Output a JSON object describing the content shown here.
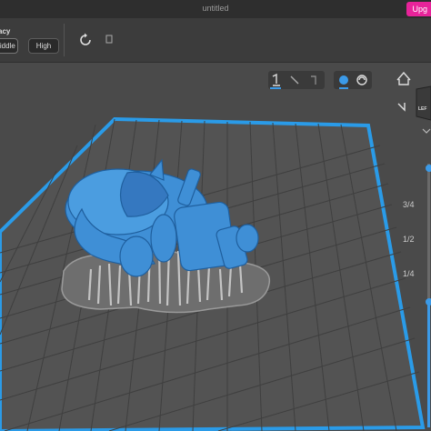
{
  "window": {
    "title": "untitled",
    "upgrade_label": "Upg"
  },
  "toolbar": {
    "accuracy_label": "acy",
    "middle_label": "Middle",
    "high_label": "High"
  },
  "view_controls": {
    "active_view": 0,
    "active_render": 0
  },
  "nav": {
    "cube_label": "LEF"
  },
  "slider": {
    "ticks": [
      "3/4",
      "1/2",
      "1/4"
    ],
    "lower_value": 0.0,
    "upper_value": 1.0
  },
  "colors": {
    "accent": "#3b9ae8",
    "brand": "#e8239a",
    "model": "#3f8fd6",
    "plate_border": "#2a9be8",
    "supports": "#bdbdbd"
  }
}
